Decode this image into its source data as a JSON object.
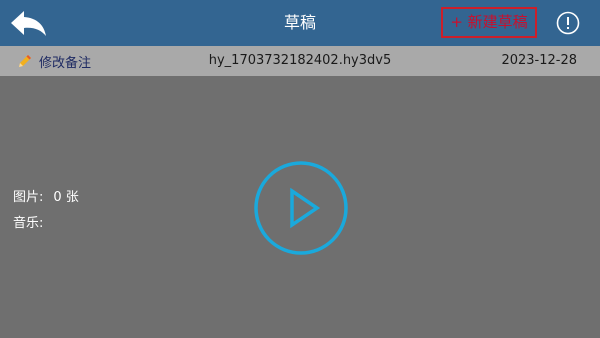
{
  "header": {
    "title": "草稿",
    "new_draft_label": "+ 新建草稿",
    "back_icon": "back-arrow-icon",
    "info_icon": "info-icon"
  },
  "draft": {
    "edit_note_label": "修改备注",
    "filename": "hy_1703732182402.hy3dv5",
    "date": "2023-12-28",
    "pictures_label": "图片:",
    "pictures_value": "0 张",
    "music_label": "音乐:",
    "music_value": ""
  },
  "colors": {
    "topbar": "#336591",
    "subbar": "#a9a9a9",
    "body": "#6f6f6f",
    "highlight_border": "#cc1f2a",
    "play_accent": "#1aa9dc"
  }
}
